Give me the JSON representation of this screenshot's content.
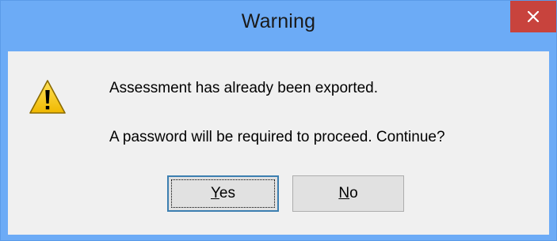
{
  "window": {
    "title": "Warning",
    "close_glyph": "✕"
  },
  "message": {
    "icon": "warning-icon",
    "line1": "Assessment has already been exported.",
    "line2": "A password will be required to proceed. Continue?"
  },
  "buttons": {
    "yes": {
      "mnemonic": "Y",
      "rest": "es"
    },
    "no": {
      "mnemonic": "N",
      "rest": "o"
    }
  },
  "colors": {
    "titlebar": "#6cabf6",
    "close_button": "#c8433d",
    "dialog_body": "#f0f0f0",
    "warning_triangle": "#f5c400"
  }
}
